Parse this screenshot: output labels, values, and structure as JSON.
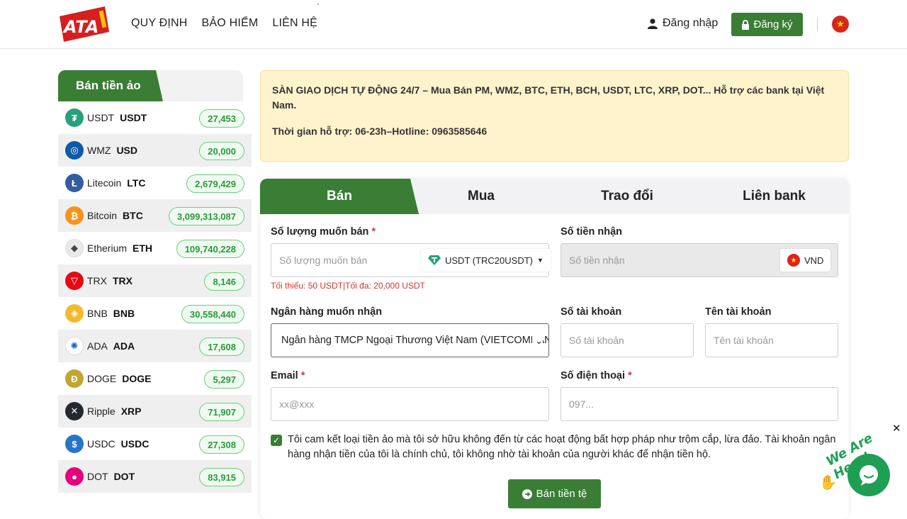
{
  "header": {
    "logo_text": "ATA",
    "nav": [
      "QUY ĐỊNH",
      "BẢO HIỂM",
      "LIÊN HỆ"
    ],
    "login_label": "Đăng nhập",
    "register_label": "Đăng ký",
    "language_flag": "vn-flag-icon"
  },
  "sidebar": {
    "title": "Bán tiền ảo",
    "coins": [
      {
        "name": "USDT",
        "code": "USDT",
        "price": "27,453",
        "icon": "usdt-icon",
        "color": "#26a17b",
        "glyph": "₮"
      },
      {
        "name": "WMZ",
        "code": "USD",
        "price": "20,000",
        "icon": "webmoney-icon",
        "color": "#0d5aa7",
        "glyph": "◎"
      },
      {
        "name": "Litecoin",
        "code": "LTC",
        "price": "2,679,429",
        "icon": "litecoin-icon",
        "color": "#345d9d",
        "glyph": "Ł"
      },
      {
        "name": "Bitcoin",
        "code": "BTC",
        "price": "3,099,313,087",
        "icon": "bitcoin-icon",
        "color": "#f7931a",
        "glyph": "₿"
      },
      {
        "name": "Etherium",
        "code": "ETH",
        "price": "109,740,228",
        "icon": "ethereum-icon",
        "color": "#e9e9e9",
        "glyph": "◆"
      },
      {
        "name": "TRX",
        "code": "TRX",
        "price": "8,146",
        "icon": "tron-icon",
        "color": "#e50914",
        "glyph": "▽"
      },
      {
        "name": "BNB",
        "code": "BNB",
        "price": "30,558,440",
        "icon": "bnb-icon",
        "color": "#f3ba2f",
        "glyph": "◈"
      },
      {
        "name": "ADA",
        "code": "ADA",
        "price": "17,608",
        "icon": "cardano-icon",
        "color": "#ffffff",
        "glyph": "✺"
      },
      {
        "name": "DOGE",
        "code": "DOGE",
        "price": "5,297",
        "icon": "dogecoin-icon",
        "color": "#c2a633",
        "glyph": "Ð"
      },
      {
        "name": "Ripple",
        "code": "XRP",
        "price": "71,907",
        "icon": "ripple-icon",
        "color": "#23292f",
        "glyph": "✕"
      },
      {
        "name": "USDC",
        "code": "USDC",
        "price": "27,308",
        "icon": "usdc-icon",
        "color": "#2775ca",
        "glyph": "$"
      },
      {
        "name": "DOT",
        "code": "DOT",
        "price": "83,915",
        "icon": "polkadot-icon",
        "color": "#e6007a",
        "glyph": "●"
      }
    ]
  },
  "notice": {
    "line1": "SÀN GIAO DỊCH TỰ ĐỘNG 24/7 – Mua Bán PM, WMZ, BTC, ETH, BCH, USDT, LTC, XRP, DOT... Hỗ trợ các bank tại Việt Nam.",
    "line2": "Thời gian hỗ trợ: 06-23h–Hotline: 0963585646"
  },
  "tabs": [
    "Bán",
    "Mua",
    "Trao đổi",
    "Liên bank"
  ],
  "form": {
    "amount_label": "Số lượng muốn bán",
    "amount_placeholder": "Số lượng muốn bán",
    "amount_currency": "USDT (TRC20USDT)",
    "amount_hint": "Tối thiểu: 50 USDT|Tối đa: 20,000 USDT",
    "receive_label": "Số tiền nhận",
    "receive_placeholder": "Số tiền nhận",
    "receive_currency": "VND",
    "bank_label": "Ngân hàng muốn nhận",
    "bank_value": "Ngân hàng TMCP Ngoại Thương Việt Nam (VIETCOMBANK)",
    "account_no_label": "Số tài khoản",
    "account_no_placeholder": "Số tài khoản",
    "account_name_label": "Tên tài khoản",
    "account_name_placeholder": "Tên tài khoản",
    "email_label": "Email",
    "email_placeholder": "xx@xxx",
    "phone_label": "Số điện thoại",
    "phone_placeholder": "097...",
    "commitment": "Tôi cam kết loại tiền ảo mà tôi sở hữu không đến từ các hoạt động bất hợp pháp như trộm cắp, lừa đảo. Tài khoản ngân hàng nhận tiền của tôi là chính chủ, tôi không nhờ tài khoản của người khác để nhận tiền hộ.",
    "submit_label": "Bán tiền tệ",
    "required_mark": "*"
  },
  "chat": {
    "banner": "We Are Here!",
    "close": "✕"
  }
}
